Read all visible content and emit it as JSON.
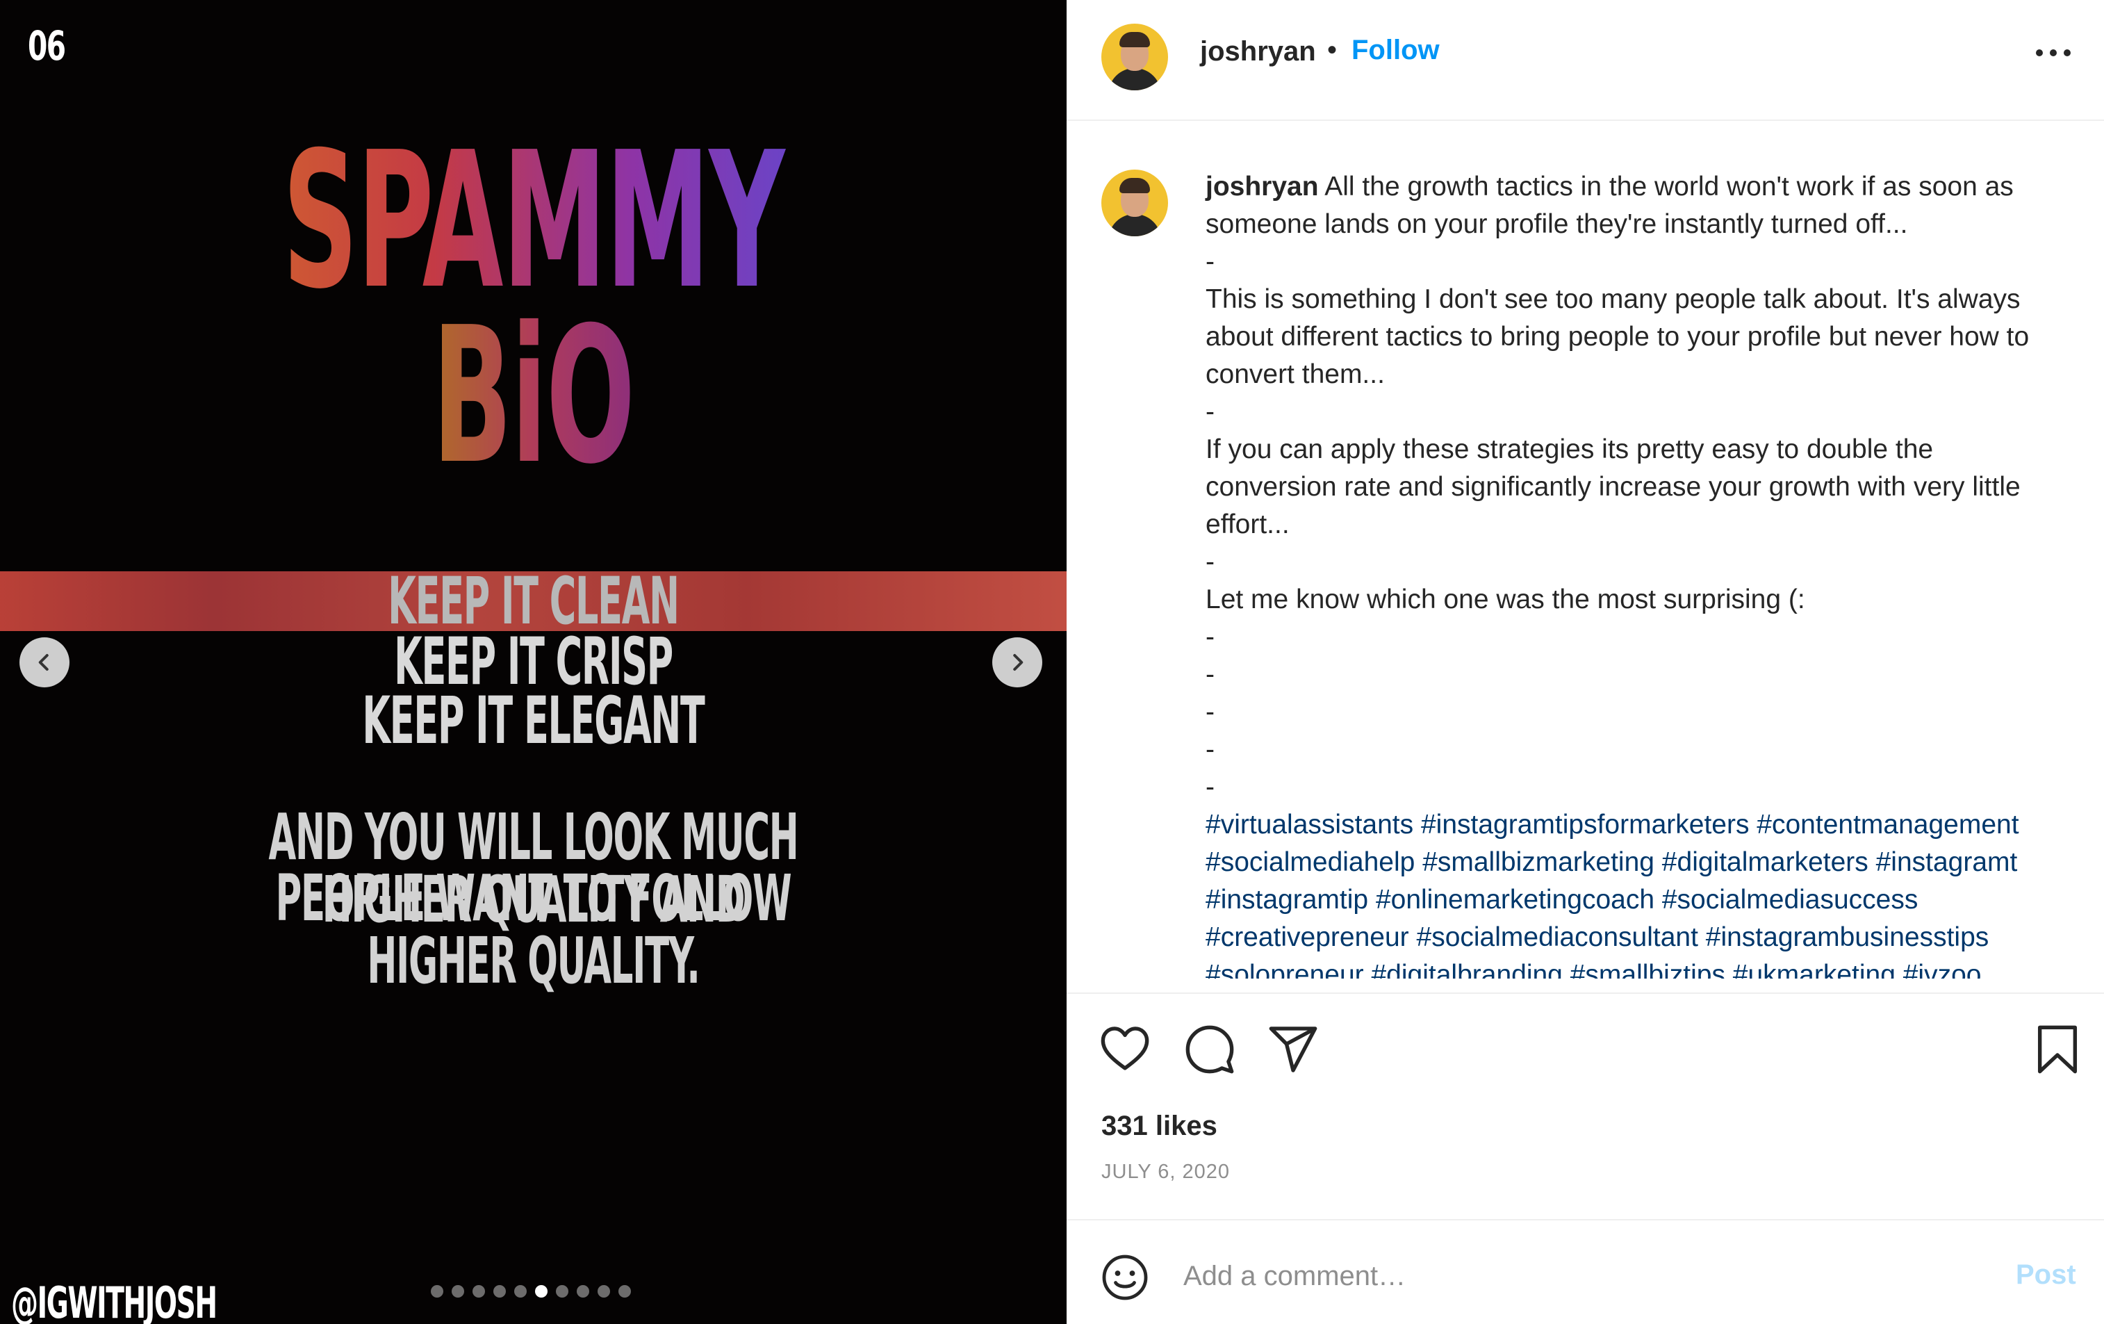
{
  "media": {
    "slide_number": "06",
    "title_line1": "SPAMMY",
    "title_line2": "BiO",
    "taglines": [
      "KEEP IT CLEAN",
      "KEEP IT CRISP",
      "KEEP IT ELEGANT"
    ],
    "bottom_text_line1": "AND YOU WILL LOOK MUCH HIGHER QUALITY AND",
    "bottom_text_line2": "PEOPLE WANT TO FOLLOW HIGHER QUALITY.",
    "watermark": "@IGWITHJOSH",
    "carousel": {
      "total_slides": 10,
      "active_index": 5
    },
    "prev_icon": "chevron-left-icon",
    "next_icon": "chevron-right-icon"
  },
  "header": {
    "username": "joshryan",
    "separator": "•",
    "follow_label": "Follow",
    "more_icon": "more-horizontal-icon"
  },
  "caption": {
    "username": "joshryan",
    "lines": [
      "All the growth tactics in the world won't work if as soon as",
      "someone lands on your profile they're instantly turned off...",
      "-",
      "This is something I don't see too many people talk about. It's always",
      "about different tactics to bring people to your profile but never how to",
      "convert them...",
      "-",
      "If you can apply these strategies its pretty easy to double the",
      "conversion rate and significantly increase your growth with very little",
      "effort...",
      "-",
      "Let me know which one was the most surprising (:",
      "-",
      "-",
      "-",
      "-",
      "-"
    ],
    "hashtag_lines": [
      "#virtualassistants #instagramtipsformarketers #contentmanagement",
      "#socialmediahelp #smallbizmarketing #digitalmarketers #instagramt",
      "#instagramtip #onlinemarketingcoach #socialmediasuccess",
      "#creativepreneur #socialmediaconsultant #instagrambusinesstips",
      "#solopreneur #digitalbranding #smallbiztips #ukmarketing #ivzoo"
    ]
  },
  "actions": {
    "like_icon": "heart-icon",
    "comment_icon": "comment-bubble-icon",
    "share_icon": "paper-plane-icon",
    "save_icon": "bookmark-icon",
    "likes": "331 likes",
    "date": "JULY 6, 2020"
  },
  "comment_bar": {
    "emoji_icon": "smiley-icon",
    "placeholder": "Add a comment…",
    "post_label": "Post"
  },
  "colors": {
    "link_blue": "#0095f6",
    "hashtag_blue": "#00376b",
    "post_disabled": "#b2dffc",
    "media_background": "#050303"
  }
}
